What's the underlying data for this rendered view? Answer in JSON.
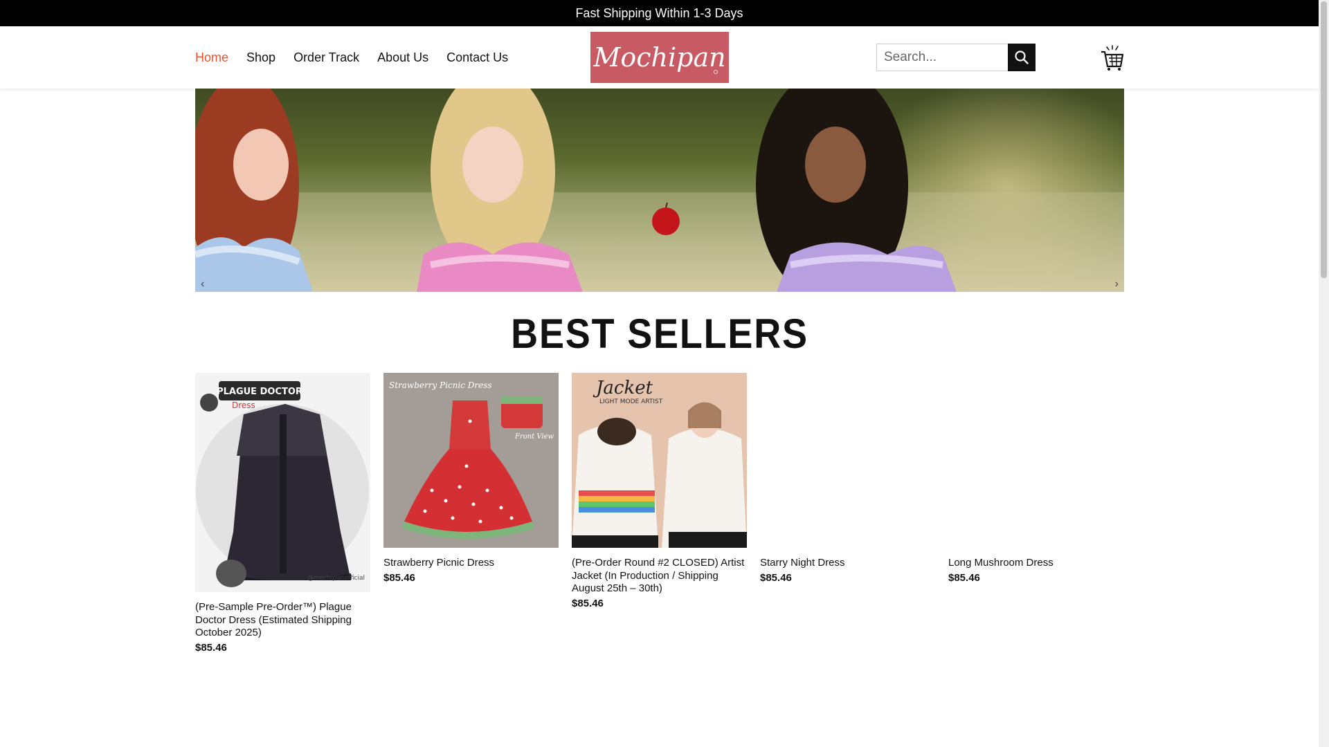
{
  "announcement": "Fast Shipping Within 1-3 Days",
  "nav": {
    "items": [
      {
        "label": "Home",
        "active": true
      },
      {
        "label": "Shop"
      },
      {
        "label": "Order Track"
      },
      {
        "label": "About Us"
      },
      {
        "label": "Contact Us"
      }
    ]
  },
  "logo": {
    "text": "Mochipan",
    "background": "#c85a63"
  },
  "search": {
    "placeholder": "Search...",
    "icon": "search-icon"
  },
  "cart": {
    "icon": "cart-icon"
  },
  "section": {
    "title": "BEST SELLERS"
  },
  "products": [
    {
      "name": "(Pre-Sample Pre-Order™) Plague Doctor Dress (Estimated Shipping October 2025)",
      "price": "$85.46",
      "image": "plague-doctor-dress",
      "image_text": [
        "PLAGUE DOCTOR",
        "Dress",
        "@mochipanofficial"
      ]
    },
    {
      "name": "Strawberry Picnic Dress",
      "price": "$85.46",
      "image": "strawberry-picnic-dress",
      "image_text": [
        "Strawberry Picnic Dress",
        "Front View"
      ]
    },
    {
      "name": "(Pre-Order Round #2 CLOSED) Artist Jacket (In Production / Shipping August 25th – 30th)",
      "price": "$85.46",
      "image": "artist-jacket",
      "image_text": [
        "Jacket",
        "LIGHT MODE ARTIST"
      ]
    },
    {
      "name": "Starry Night Dress",
      "price": "$85.46",
      "image": "none"
    },
    {
      "name": "Long Mushroom Dress",
      "price": "$85.46",
      "image": "none"
    }
  ],
  "colors": {
    "accent": "#e8542e",
    "topbar": "#000000",
    "logo": "#c85a63"
  }
}
